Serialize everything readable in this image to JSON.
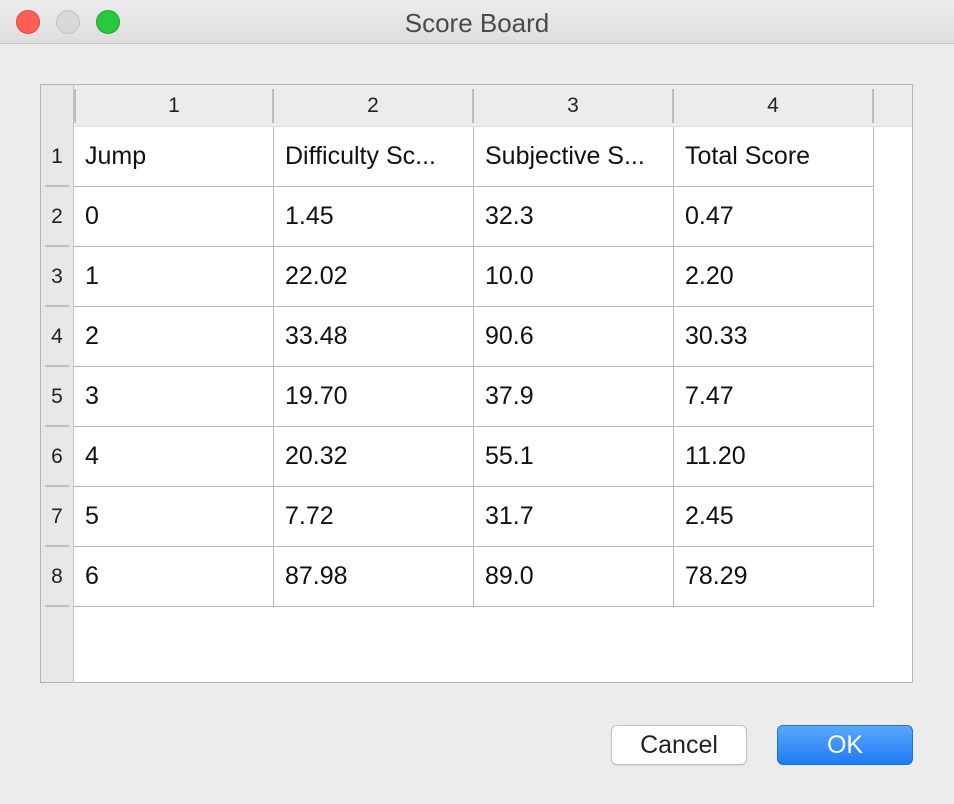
{
  "window": {
    "title": "Score Board"
  },
  "table": {
    "column_headers": [
      "1",
      "2",
      "3",
      "4"
    ],
    "row_headers": [
      "1",
      "2",
      "3",
      "4",
      "5",
      "6",
      "7",
      "8"
    ],
    "rows": [
      [
        "Jump",
        "Difficulty Sc...",
        "Subjective S...",
        "Total Score"
      ],
      [
        "0",
        "1.45",
        "32.3",
        "0.47"
      ],
      [
        "1",
        "22.02",
        "10.0",
        "2.20"
      ],
      [
        "2",
        "33.48",
        "90.6",
        "30.33"
      ],
      [
        "3",
        "19.70",
        "37.9",
        "7.47"
      ],
      [
        "4",
        "20.32",
        "55.1",
        "11.20"
      ],
      [
        "5",
        "7.72",
        "31.7",
        "2.45"
      ],
      [
        "6",
        "87.98",
        "89.0",
        "78.29"
      ]
    ]
  },
  "buttons": {
    "cancel_label": "Cancel",
    "ok_label": "OK"
  },
  "colors": {
    "close": "#ff5f57",
    "minimize": "#d8d8d8",
    "maximize": "#28c840",
    "ok_button": "#1e7cf5"
  }
}
